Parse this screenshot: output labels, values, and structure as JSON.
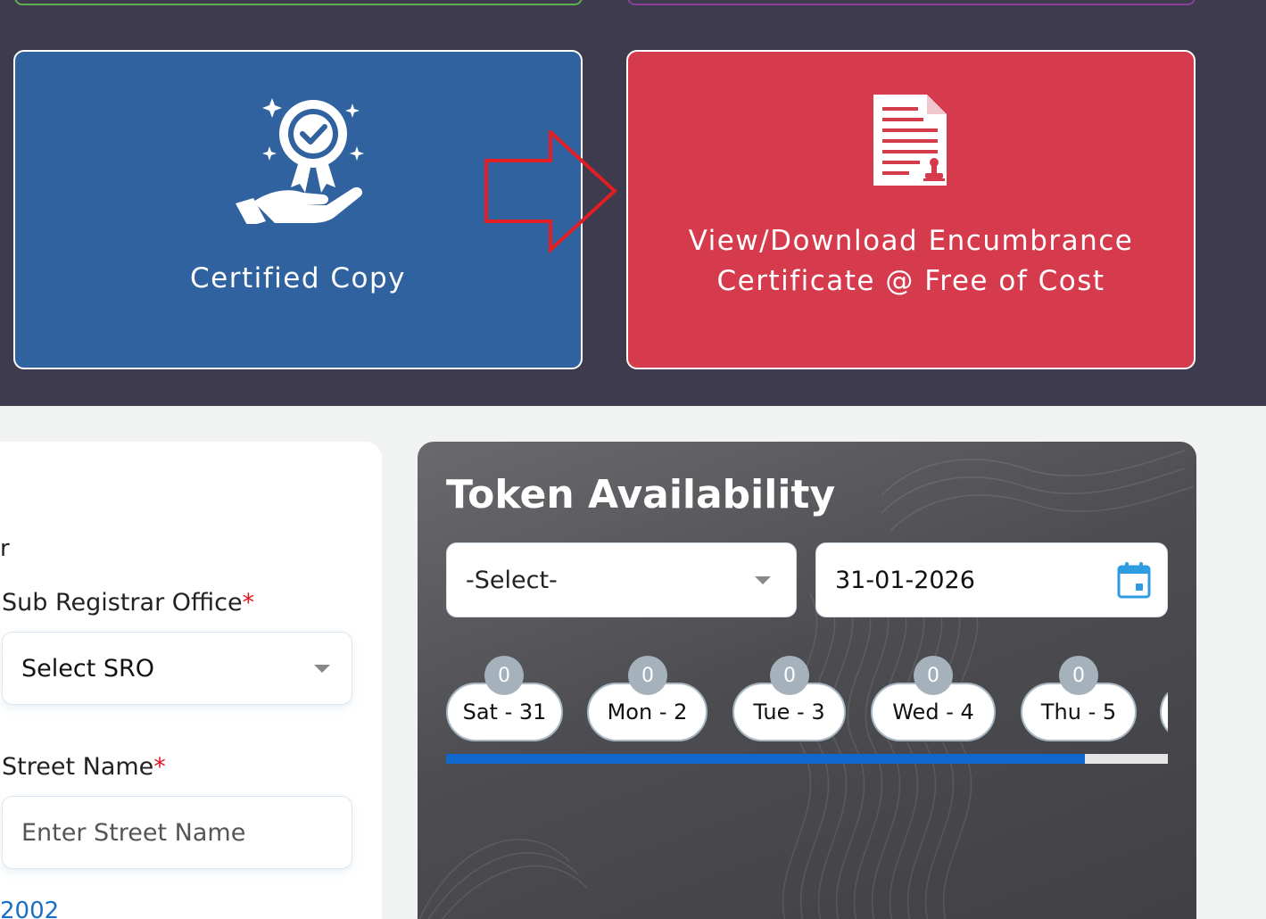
{
  "tiles": {
    "certified_copy": {
      "label": "Certified Copy",
      "icon": "award-in-hand-icon"
    },
    "encumbrance": {
      "label_line1": "View/Download Encumbrance",
      "label_line2": "Certificate @ Free of Cost",
      "icon": "stamped-document-icon"
    }
  },
  "form": {
    "fragment_label": "r",
    "sro": {
      "label": "Sub Registrar Office",
      "required_mark": "*",
      "value": "Select SRO"
    },
    "street": {
      "label": "Street Name",
      "required_mark": "*",
      "placeholder": "Enter Street Name"
    },
    "link_fragment": "2002"
  },
  "token": {
    "title": "Token Availability",
    "select_value": "-Select-",
    "date_value": "31-01-2026",
    "days": [
      {
        "label": "Sat - 31",
        "count": "0"
      },
      {
        "label": "Mon - 2",
        "count": "0"
      },
      {
        "label": "Tue - 3",
        "count": "0"
      },
      {
        "label": "Wed - 4",
        "count": "0"
      },
      {
        "label": "Thu - 5",
        "count": "0"
      }
    ],
    "scroll_position_fraction": 0.885
  },
  "colors": {
    "blue_tile": "#3062a0",
    "red_tile": "#d53a4d",
    "dark_band": "#3d3b4d",
    "required": "#e0121f",
    "scroll_thumb": "#1067cc"
  }
}
